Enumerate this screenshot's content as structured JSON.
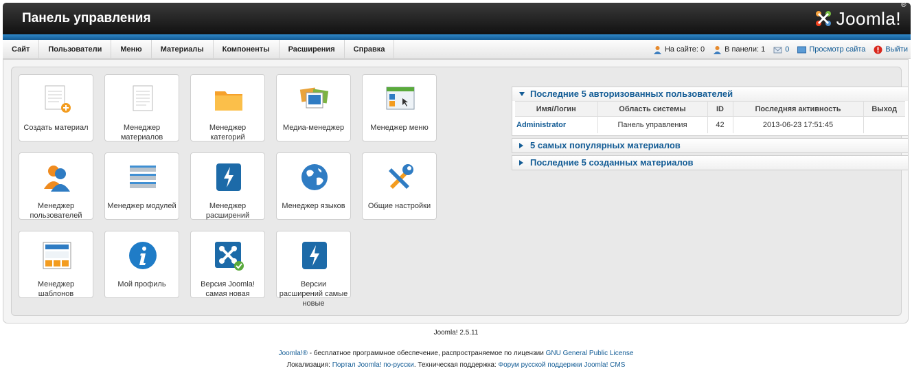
{
  "header": {
    "title": "Панель управления",
    "logo_text": "Joomla!",
    "logo_sup": "®"
  },
  "menu": [
    {
      "label": "Сайт"
    },
    {
      "label": "Пользователи"
    },
    {
      "label": "Меню"
    },
    {
      "label": "Материалы"
    },
    {
      "label": "Компоненты"
    },
    {
      "label": "Расширения"
    },
    {
      "label": "Справка"
    }
  ],
  "status": {
    "on_site": "На сайте: 0",
    "in_panel": "В панели: 1",
    "messages": "0",
    "view_site": "Просмотр сайта",
    "logout": "Выйти"
  },
  "tiles": [
    {
      "label": "Создать материал",
      "icon": "article-add-icon"
    },
    {
      "label": "Менеджер материалов",
      "icon": "article-icon"
    },
    {
      "label": "Менеджер категорий",
      "icon": "folder-icon"
    },
    {
      "label": "Медиа-менеджер",
      "icon": "media-icon"
    },
    {
      "label": "Менеджер меню",
      "icon": "menu-icon"
    },
    {
      "label": "Менеджер пользователей",
      "icon": "users-icon"
    },
    {
      "label": "Менеджер модулей",
      "icon": "modules-icon"
    },
    {
      "label": "Менеджер расширений",
      "icon": "extensions-icon"
    },
    {
      "label": "Менеджер языков",
      "icon": "globe-icon"
    },
    {
      "label": "Общие настройки",
      "icon": "tools-icon"
    },
    {
      "label": "Менеджер шаблонов",
      "icon": "template-icon"
    },
    {
      "label": "Мой профиль",
      "icon": "info-icon"
    },
    {
      "label": "Версия Joomla! самая новая",
      "icon": "joomla-check-icon"
    },
    {
      "label": "Версии расширений самые новые",
      "icon": "extensions-icon"
    }
  ],
  "panes": {
    "users": {
      "title": "Последние 5 авторизованных пользователей",
      "columns": [
        "Имя/Логин",
        "Область системы",
        "ID",
        "Последняя активность",
        "Выход"
      ],
      "rows": [
        {
          "login": "Administrator",
          "area": "Панель управления",
          "id": "42",
          "activity": "2013-06-23 17:51:45",
          "logout": ""
        }
      ]
    },
    "popular": {
      "title": "5 самых популярных материалов"
    },
    "recent": {
      "title": "Последние 5 созданных материалов"
    }
  },
  "footer": {
    "version": "Joomla! 2.5.11",
    "line1_brand": "Joomla!®",
    "line1_text": " - бесплатное программное обеспечение, распространяемое по лицензии ",
    "line1_link": "GNU General Public License",
    "line2_label": "Локализация: ",
    "line2_link1": "Портал Joomla! по-русски",
    "line2_mid": ". Техническая поддержка: ",
    "line2_link2": "Форум русской поддержки Joomla! CMS"
  },
  "colors": {
    "accent": "#135c95",
    "header": "#111111",
    "strip": "#2f87c7"
  }
}
